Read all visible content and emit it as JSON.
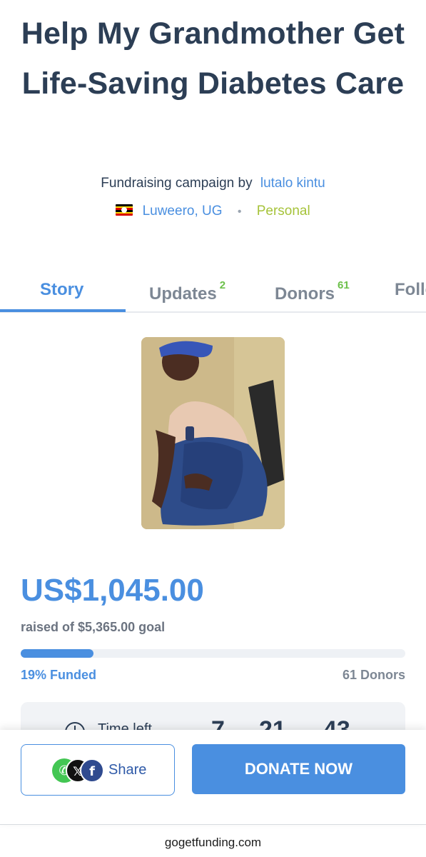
{
  "campaign": {
    "title": "Help My Grandmother Get Life-Saving Diabetes Care",
    "byline_prefix": "Fundraising campaign by",
    "author": "lutalo kintu",
    "location": "Luweero, UG",
    "category": "Personal"
  },
  "tabs": [
    {
      "label": "Story",
      "count": "",
      "active": true
    },
    {
      "label": "Updates",
      "count": "2",
      "active": false
    },
    {
      "label": "Donors",
      "count": "61",
      "active": false
    },
    {
      "label": "Follo",
      "count": "",
      "active": false
    }
  ],
  "funding": {
    "raised": "US$1,045.00",
    "goal_text": "raised of $5,365.00 goal",
    "progress_fraction": 0.19,
    "funded_label": "19% Funded",
    "donors_label": "61 Donors"
  },
  "time_left": {
    "label": "Time left",
    "values": [
      "7",
      "21",
      "43"
    ]
  },
  "actions": {
    "share_label": "Share",
    "donate_label": "DONATE NOW"
  },
  "footer": {
    "domain": "gogetfunding.com"
  },
  "colors": {
    "accent": "#4a8fe0",
    "title": "#2c3e55",
    "category": "#a6c33a",
    "badge": "#6cc04a"
  },
  "icons": {
    "flag": "uganda-flag-icon",
    "share": [
      "whatsapp-icon",
      "x-icon",
      "facebook-icon"
    ],
    "clock": "clock-icon"
  }
}
